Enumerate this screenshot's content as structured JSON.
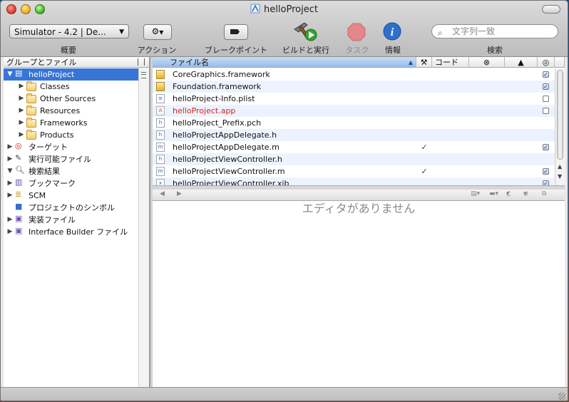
{
  "window": {
    "title": "helloProject"
  },
  "toolbar": {
    "scheme_popup": "Simulator - 4.2 | De...",
    "labels": {
      "overview": "概要",
      "action": "アクション",
      "breakpoints": "ブレークポイント",
      "build_run": "ビルドと実行",
      "tasks": "タスク",
      "info": "情報",
      "search": "検索"
    },
    "search_placeholder": "文字列一致"
  },
  "sidebar": {
    "header": "グループとファイル",
    "items": [
      {
        "label": "helloProject",
        "level": 0,
        "disclosure": "▼",
        "icon": "project-icon",
        "selected": true
      },
      {
        "label": "Classes",
        "level": 1,
        "disclosure": "▶",
        "icon": "folder-icon"
      },
      {
        "label": "Other Sources",
        "level": 1,
        "disclosure": "▶",
        "icon": "folder-icon"
      },
      {
        "label": "Resources",
        "level": 1,
        "disclosure": "▶",
        "icon": "folder-icon"
      },
      {
        "label": "Frameworks",
        "level": 1,
        "disclosure": "▶",
        "icon": "folder-icon"
      },
      {
        "label": "Products",
        "level": 1,
        "disclosure": "▶",
        "icon": "folder-icon"
      },
      {
        "label": "ターゲット",
        "level": 0,
        "disclosure": "▶",
        "icon": "target-icon"
      },
      {
        "label": "実行可能ファイル",
        "level": 0,
        "disclosure": "▶",
        "icon": "executable-icon"
      },
      {
        "label": "検索結果",
        "level": 0,
        "disclosure": "▼",
        "icon": "magnifier-icon"
      },
      {
        "label": "ブックマーク",
        "level": 0,
        "disclosure": "▶",
        "icon": "bookmark-icon"
      },
      {
        "label": "SCM",
        "level": 0,
        "disclosure": "▶",
        "icon": "scm-icon"
      },
      {
        "label": "プロジェクトのシンボル",
        "level": 0,
        "disclosure": "",
        "icon": "cube-icon"
      },
      {
        "label": "実装ファイル",
        "level": 0,
        "disclosure": "▶",
        "icon": "smart-folder-icon"
      },
      {
        "label": "Interface Builder ファイル",
        "level": 0,
        "disclosure": "▶",
        "icon": "smart-folder-icon"
      }
    ]
  },
  "table": {
    "headers": {
      "filename": "ファイル名",
      "code": "コード"
    },
    "rows": [
      {
        "name": "CoreGraphics.framework",
        "type": "framework",
        "built": false,
        "checked": true
      },
      {
        "name": "Foundation.framework",
        "type": "framework",
        "built": false,
        "checked": true
      },
      {
        "name": "helloProject-Info.plist",
        "type": "plist",
        "built": false,
        "checked": false
      },
      {
        "name": "helloProject.app",
        "type": "app",
        "built": false,
        "checked": false,
        "missing": true
      },
      {
        "name": "helloProject_Prefix.pch",
        "type": "h",
        "built": false,
        "checked": null
      },
      {
        "name": "helloProjectAppDelegate.h",
        "type": "h",
        "built": false,
        "checked": null
      },
      {
        "name": "helloProjectAppDelegate.m",
        "type": "m",
        "built": true,
        "checked": true
      },
      {
        "name": "helloProjectViewController.h",
        "type": "h",
        "built": false,
        "checked": null
      },
      {
        "name": "helloProjectViewController.m",
        "type": "m",
        "built": true,
        "checked": true
      },
      {
        "name": "helloProjectViewController.xib",
        "type": "xib",
        "built": false,
        "checked": true
      }
    ]
  },
  "editor": {
    "empty_message": "エディタがありません",
    "nav_back": "◀",
    "nav_forward": "▶",
    "class_menu": "C",
    "hash_menu": "#"
  },
  "colors": {
    "selection": "#3875d7",
    "missing_file": "#d52222",
    "row_alt": "#edf3fe"
  }
}
